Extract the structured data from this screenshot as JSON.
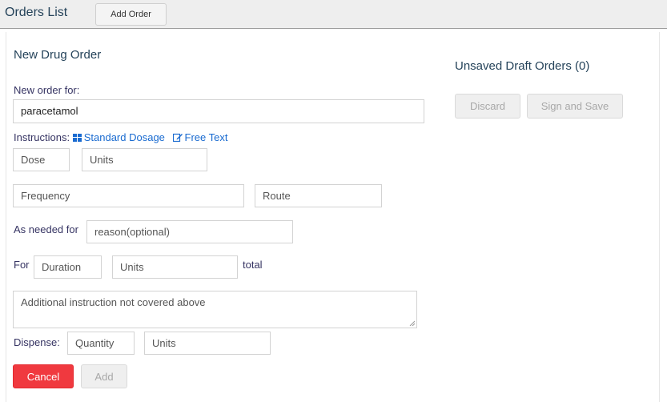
{
  "header": {
    "title": "Orders List",
    "add_order_label": "Add Order"
  },
  "form": {
    "title": "New Drug Order",
    "new_order_for_label": "New order for:",
    "drug_value": "paracetamol",
    "instructions_label": "Instructions:",
    "standard_dosage_link": "Standard Dosage",
    "free_text_link": "Free Text",
    "dose_placeholder": "Dose",
    "dose_units_placeholder": "Units",
    "frequency_placeholder": "Frequency",
    "route_placeholder": "Route",
    "as_needed_label": "As needed for",
    "reason_placeholder": "reason(optional)",
    "for_label": "For",
    "duration_placeholder": "Duration",
    "duration_units_placeholder": "Units",
    "total_label": "total",
    "additional_instruction_placeholder": "Additional instruction not covered above",
    "dispense_label": "Dispense:",
    "quantity_placeholder": "Quantity",
    "quantity_units_placeholder": "Units",
    "cancel_label": "Cancel",
    "add_label": "Add"
  },
  "drafts": {
    "title": "Unsaved Draft Orders (0)",
    "discard_label": "Discard",
    "sign_save_label": "Sign and Save"
  },
  "colors": {
    "link": "#1a6bd0",
    "cancel": "#f0393f",
    "heading": "#25435a"
  }
}
